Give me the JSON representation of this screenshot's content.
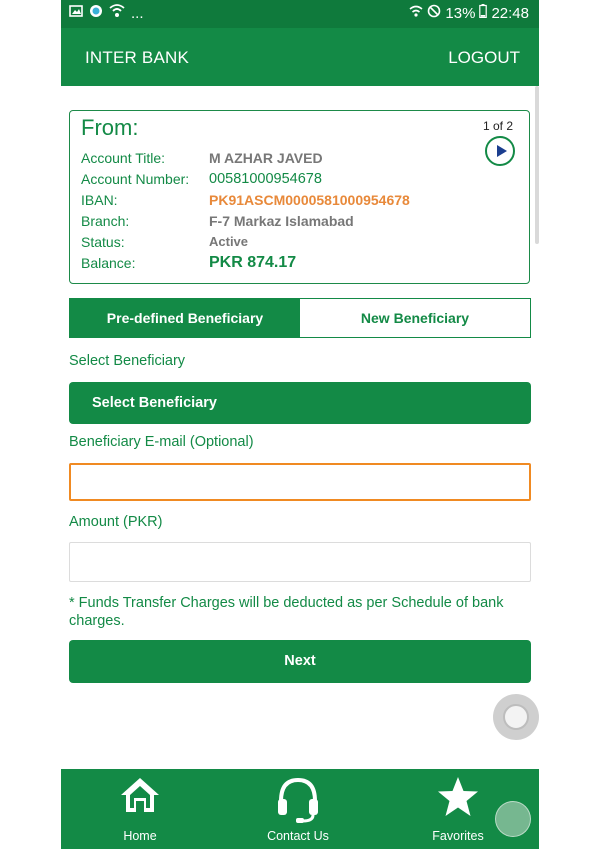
{
  "status_bar": {
    "left_text": "...",
    "battery": "13%",
    "time": "22:48",
    "icons": [
      "image-icon",
      "app-dot-icon",
      "shield-icon",
      "wifi-icon",
      "no-disturb-icon",
      "battery-icon"
    ]
  },
  "app_bar": {
    "title": "INTER BANK",
    "logout_label": "LOGOUT"
  },
  "account_card": {
    "from_label": "From:",
    "pager": "1 of 2",
    "rows": [
      {
        "label": "Account Title:",
        "value": "M AZHAR JAVED"
      },
      {
        "label": "Account Number:",
        "value": "00581000954678"
      },
      {
        "label": "IBAN:",
        "value": "PK91ASCM0000581000954678"
      },
      {
        "label": "Branch:",
        "value": "F-7 Markaz Islamabad"
      },
      {
        "label": "Status:",
        "value": "Active"
      },
      {
        "label": "Balance:",
        "value": "PKR 874.17"
      }
    ]
  },
  "tabs": {
    "predefined": "Pre-defined Beneficiary",
    "new": "New Beneficiary"
  },
  "form": {
    "select_label": "Select Beneficiary",
    "select_value": "Select Beneficiary",
    "email_label": "Beneficiary E-mail (Optional)",
    "email_value": "",
    "amount_label": "Amount (PKR)",
    "amount_value": "",
    "note": "* Funds Transfer Charges will be deducted as per Schedule of bank charges.",
    "next_label": "Next"
  },
  "bottom_nav": {
    "items": [
      {
        "label": "Home",
        "icon": "home-icon"
      },
      {
        "label": "Contact Us",
        "icon": "headset-icon"
      },
      {
        "label": "Favorites",
        "icon": "star-icon"
      }
    ]
  },
  "colors": {
    "primary_green": "#138a46",
    "status_green": "#0f7a3c",
    "iban_orange": "#e8893a",
    "focus_orange": "#f08a22"
  }
}
